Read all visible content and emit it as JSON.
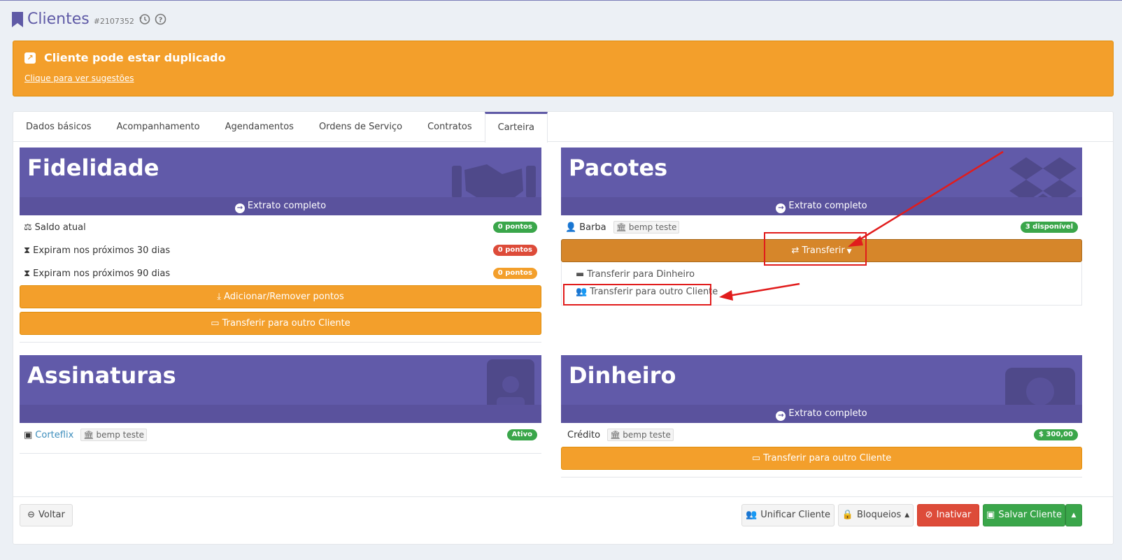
{
  "header": {
    "title": "Clientes",
    "code": "#2107352",
    "history_icon": "history-icon",
    "help_icon": "help-icon"
  },
  "alert": {
    "title": "Cliente pode estar duplicado",
    "link": "Clique para ver sugestões"
  },
  "tabs": [
    {
      "label": "Dados básicos"
    },
    {
      "label": "Acompanhamento"
    },
    {
      "label": "Agendamentos"
    },
    {
      "label": "Ordens de Serviço"
    },
    {
      "label": "Contratos"
    },
    {
      "label": "Carteira"
    }
  ],
  "fidelidade": {
    "title": "Fidelidade",
    "extrato": "Extrato completo",
    "rows": [
      {
        "label": "Saldo atual",
        "badge": "0 pontos"
      },
      {
        "label": "Expiram nos próximos 30 dias",
        "badge": "0 pontos"
      },
      {
        "label": "Expiram nos próximos 90 dias",
        "badge": "0 pontos"
      }
    ],
    "add_remove": "Adicionar/Remover pontos",
    "transfer": "Transferir para outro Cliente"
  },
  "pacotes": {
    "title": "Pacotes",
    "extrato": "Extrato completo",
    "item_name": "Barba",
    "item_tag": "bemp teste",
    "item_badge": "3 disponível",
    "transfer_btn": "Transferir",
    "menu": [
      {
        "label": "Transferir para Dinheiro"
      },
      {
        "label": "Transferir para outro Cliente"
      }
    ]
  },
  "assinaturas": {
    "title": "Assinaturas",
    "item_name": "Corteflix",
    "item_tag": "bemp teste",
    "item_badge": "Ativo"
  },
  "dinheiro": {
    "title": "Dinheiro",
    "extrato": "Extrato completo",
    "item_name": "Crédito",
    "item_tag": "bemp teste",
    "item_badge": "$ 300,00",
    "transfer": "Transferir para outro Cliente"
  },
  "footer": {
    "back": "Voltar",
    "unify": "Unificar Cliente",
    "blocks": "Bloqueios",
    "deactivate": "Inativar",
    "save": "Salvar Cliente"
  },
  "colors": {
    "primary": "#615aa9",
    "warning": "#f39f2b",
    "danger": "#dd4b39",
    "success": "#3aa64a",
    "annotation": "#e11c1c"
  }
}
